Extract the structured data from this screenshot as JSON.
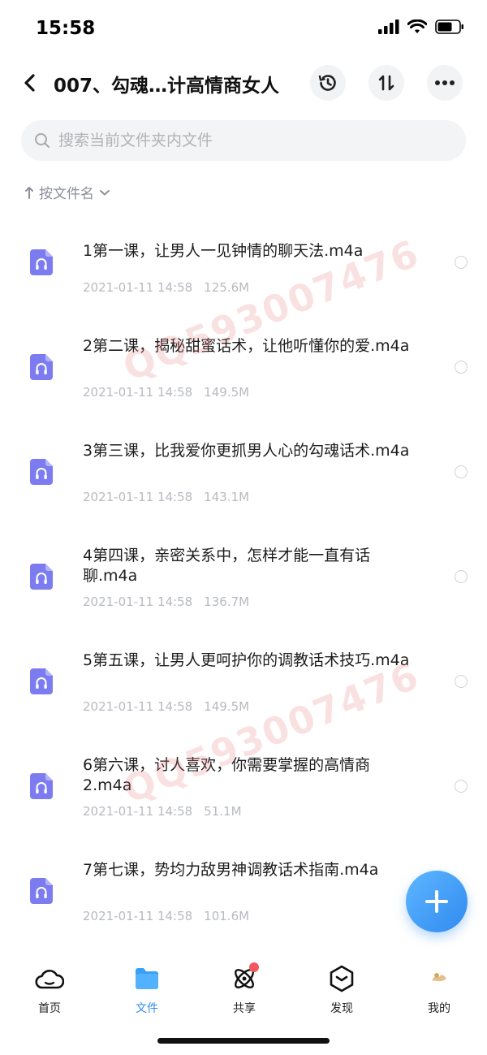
{
  "status_bar": {
    "time": "15:58"
  },
  "nav": {
    "title": "007、勾魂…计高情商女人"
  },
  "search": {
    "placeholder": "搜索当前文件夹内文件"
  },
  "sort": {
    "label": "按文件名"
  },
  "files": [
    {
      "name": "1第一课，让男人一见钟情的聊天法.m4a",
      "date": "2021-01-11 14:58",
      "size": "125.6M"
    },
    {
      "name": "2第二课，揭秘甜蜜话术，让他听懂你的爱.m4a",
      "date": "2021-01-11 14:58",
      "size": "149.5M"
    },
    {
      "name": "3第三课，比我爱你更抓男人心的勾魂话术.m4a",
      "date": "2021-01-11 14:58",
      "size": "143.1M"
    },
    {
      "name": "4第四课，亲密关系中，怎样才能一直有话聊.m4a",
      "date": "2021-01-11 14:58",
      "size": "136.7M"
    },
    {
      "name": "5第五课，让男人更呵护你的调教话术技巧.m4a",
      "date": "2021-01-11 14:58",
      "size": "149.5M"
    },
    {
      "name": "6第六课，讨人喜欢，你需要掌握的高情商 2.m4a",
      "date": "2021-01-11 14:58",
      "size": "51.1M"
    },
    {
      "name": "7第七课，势均力敌男神调教话术指南.m4a",
      "date": "2021-01-11 14:58",
      "size": "101.6M"
    }
  ],
  "watermark": "QQ593007476",
  "tabs": [
    {
      "label": "首页",
      "icon": "cloud-icon",
      "active": false
    },
    {
      "label": "文件",
      "icon": "folder-icon",
      "active": true
    },
    {
      "label": "共享",
      "icon": "atom-icon",
      "active": false,
      "badge": true
    },
    {
      "label": "发现",
      "icon": "discover-icon",
      "active": false
    },
    {
      "label": "我的",
      "icon": "avatar-icon",
      "active": false
    }
  ],
  "colors": {
    "accent": "#2f8bf0",
    "file_icon": "#7c7cf0",
    "badge": "#f0595e"
  }
}
